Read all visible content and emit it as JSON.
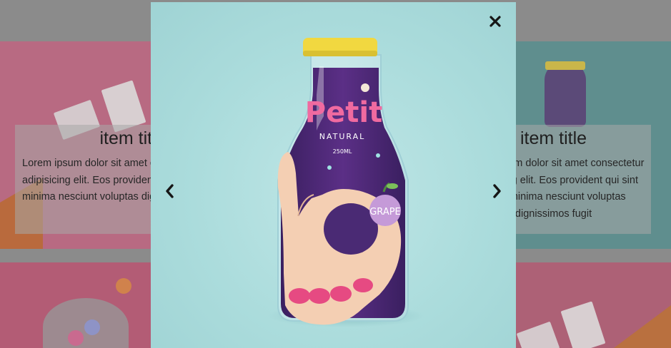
{
  "background_cards": [
    {
      "title": "item title",
      "description": "Lorem ipsum dolor sit amet consectetur adipisicing elit. Eos provident qui sint fugiat minima nesciunt voluptas dignissimos fugit"
    },
    {
      "title": "item title",
      "description": "Lorem ipsum dolor sit amet consectetur adipisicing elit. Eos provident qui sint fugiat minima nesciunt voluptas dignissimos fugit"
    }
  ],
  "lightbox": {
    "product": {
      "brand": "Petit",
      "subbrand": "NATURAL",
      "volume": "250ML",
      "flavor": "GRAPE"
    },
    "icons": {
      "close": "close-icon",
      "prev": "chevron-left-icon",
      "next": "chevron-right-icon"
    }
  },
  "colors": {
    "lightbox_bg": "#abdcdc",
    "overlay": "#8b8b8b",
    "lid": "#f1d840",
    "juice": "#4a2a74"
  }
}
